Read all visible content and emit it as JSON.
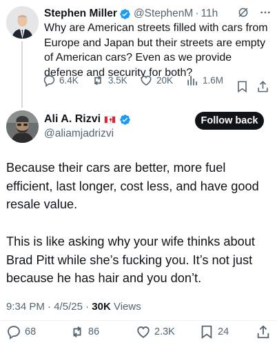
{
  "parent_tweet": {
    "author_name": "Stephen Miller",
    "handle": "@StephenM",
    "separator": "·",
    "time": "11h",
    "text": "Why are American streets filled with cars from Europe and Japan but their streets are empty of American cars? Even as we provide defense and security for both?",
    "replies": "6.4K",
    "reposts": "3.5K",
    "likes": "20K",
    "views": "1.6M"
  },
  "reply_tweet": {
    "author_name": "Ali A. Rizvi",
    "handle": "@aliamjadrizvi",
    "follow_label": "Follow back",
    "paragraph_1": "Because their cars are better, more fuel efficient, last longer, cost less, and have good resale value.",
    "paragraph_2": "This is like asking why your wife thinks about Brad Pitt while she’s fucking you. It’s not just because he has hair and you don’t.",
    "time": "9:34 PM",
    "date": "4/5/25",
    "meta_separator": "·",
    "views_count": "30K",
    "views_label": "Views",
    "replies": "68",
    "reposts": "86",
    "likes": "2.3K",
    "bookmarks": "24"
  },
  "icons": {
    "verified": "verified-badge-icon",
    "grok": "grok-icon",
    "more": "more-icon",
    "reply": "reply-icon",
    "repost": "repost-icon",
    "like": "like-icon",
    "views": "views-icon",
    "bookmark": "bookmark-icon",
    "share": "share-icon",
    "flag": "canada-flag-icon"
  },
  "colors": {
    "text": "#0f1419",
    "secondary": "#536471",
    "verified": "#1d9bf0",
    "button": "#0f1419"
  }
}
